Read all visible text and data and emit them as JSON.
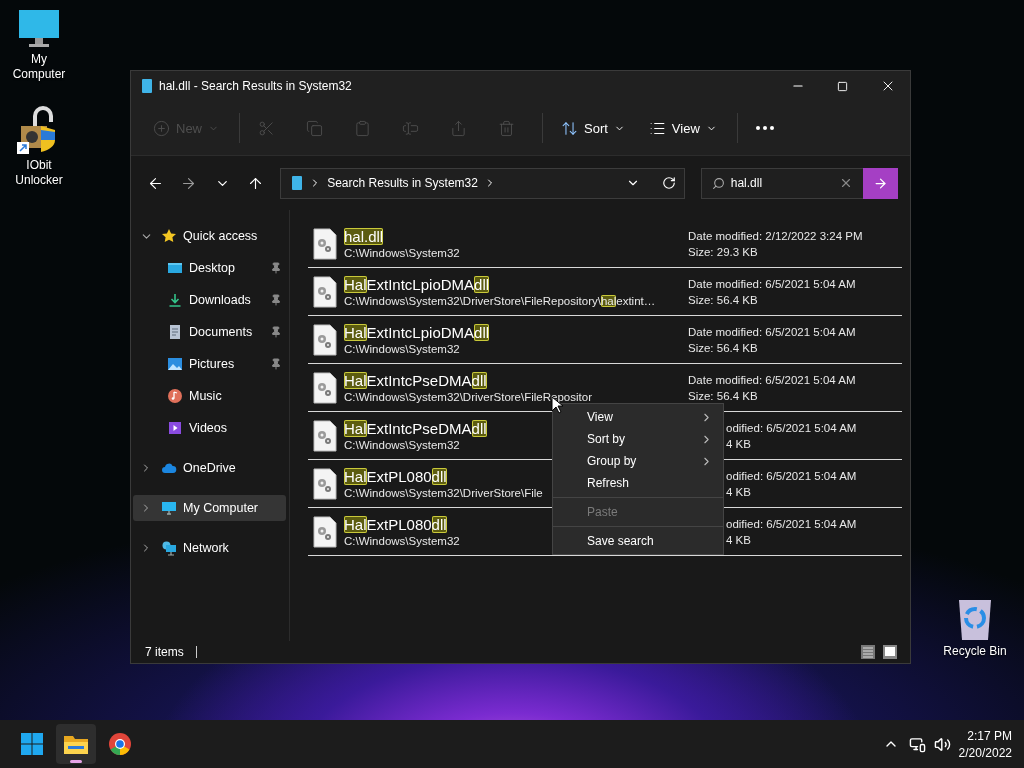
{
  "desktop_icons": [
    {
      "kind": "computer",
      "label": "My Computer"
    },
    {
      "kind": "unlocker",
      "label": "IObit Unlocker"
    },
    {
      "kind": "recycle",
      "label": "Recycle Bin"
    }
  ],
  "window": {
    "title": "hal.dll - Search Results in System32",
    "toolbar": [
      {
        "kind": "new",
        "label": "New",
        "disabled": true
      },
      {
        "kind": "separator"
      },
      {
        "kind": "cut",
        "disabled": true
      },
      {
        "kind": "copy",
        "disabled": true
      },
      {
        "kind": "paste",
        "disabled": true
      },
      {
        "kind": "rename",
        "disabled": true
      },
      {
        "kind": "share",
        "disabled": true
      },
      {
        "kind": "delete",
        "disabled": true
      },
      {
        "kind": "separator"
      },
      {
        "kind": "sort",
        "label": "Sort",
        "disabled": false
      },
      {
        "kind": "view",
        "label": "View",
        "disabled": false
      },
      {
        "kind": "separator"
      },
      {
        "kind": "more",
        "disabled": false
      }
    ],
    "address": {
      "crumb": "Search Results in System32"
    },
    "search": {
      "value": "hal.dll"
    },
    "sidebar": [
      {
        "kind": "star",
        "label": "Quick access",
        "expanded": true,
        "selected": false,
        "children": [
          {
            "kind": "desktop",
            "label": "Desktop",
            "pinned": true,
            "selected": false
          },
          {
            "kind": "download",
            "label": "Downloads",
            "pinned": true,
            "selected": false
          },
          {
            "kind": "documents",
            "label": "Documents",
            "pinned": true,
            "selected": false
          },
          {
            "kind": "pictures",
            "label": "Pictures",
            "pinned": true,
            "selected": false
          },
          {
            "kind": "music",
            "label": "Music",
            "pinned": false,
            "selected": false
          },
          {
            "kind": "videos",
            "label": "Videos",
            "pinned": false,
            "selected": false
          }
        ]
      },
      {
        "kind": "cloud",
        "label": "OneDrive",
        "expanded": false,
        "selected": false
      },
      {
        "kind": "computer",
        "label": "My Computer",
        "expanded": false,
        "selected": true
      },
      {
        "kind": "network",
        "label": "Network",
        "expanded": false,
        "selected": false
      }
    ],
    "results": [
      {
        "kind": "full",
        "name": [
          {
            "text": "hal.dll",
            "match": true
          }
        ],
        "path": [
          {
            "text": "C:\\Windows\\System32",
            "match": false
          }
        ],
        "date": "Date modified: 2/12/2022 3:24 PM",
        "size": "Size: 29.3 KB"
      },
      {
        "kind": "full",
        "name": [
          {
            "text": "Hal",
            "match": true
          },
          {
            "text": "ExtIntcLpioDMA",
            "match": false
          },
          {
            "text": "dll",
            "match": true
          }
        ],
        "path": [
          {
            "text": "C:\\Windows\\System32\\DriverStore\\FileRepository\\",
            "match": false
          },
          {
            "text": "hal",
            "match": true
          },
          {
            "text": "extint…",
            "match": false
          }
        ],
        "date": "Date modified: 6/5/2021 5:04 AM",
        "size": "Size: 56.4 KB"
      },
      {
        "kind": "full",
        "name": [
          {
            "text": "Hal",
            "match": true
          },
          {
            "text": "ExtIntcLpioDMA",
            "match": false
          },
          {
            "text": "dll",
            "match": true
          }
        ],
        "path": [
          {
            "text": "C:\\Windows\\System32",
            "match": false
          }
        ],
        "date": "Date modified: 6/5/2021 5:04 AM",
        "size": "Size: 56.4 KB"
      },
      {
        "kind": "full",
        "name": [
          {
            "text": "Hal",
            "match": true
          },
          {
            "text": "ExtIntcPseDMA",
            "match": false
          },
          {
            "text": "dll",
            "match": true
          }
        ],
        "path": [
          {
            "text": "C:\\Windows\\System32\\DriverStore\\FileRepositor",
            "match": false
          }
        ],
        "date": "Date modified: 6/5/2021 5:04 AM",
        "size": "Size: 56.4 KB"
      },
      {
        "kind": "covered",
        "name": [
          {
            "text": "Hal",
            "match": true
          },
          {
            "text": "ExtIntcPseDMA",
            "match": false
          },
          {
            "text": "dll",
            "match": true
          }
        ],
        "path": [
          {
            "text": "C:\\Windows\\System32",
            "match": false
          }
        ],
        "date": "odified: 6/5/2021 5:04 AM",
        "size": "4 KB"
      },
      {
        "kind": "covered",
        "name": [
          {
            "text": "Hal",
            "match": true
          },
          {
            "text": "ExtPL080",
            "match": false
          },
          {
            "text": "dll",
            "match": true
          }
        ],
        "path": [
          {
            "text": "C:\\Windows\\System32\\DriverStore\\File",
            "match": false
          }
        ],
        "date": "odified: 6/5/2021 5:04 AM",
        "size": "4 KB"
      },
      {
        "kind": "covered",
        "name": [
          {
            "text": "Hal",
            "match": true
          },
          {
            "text": "ExtPL080",
            "match": false
          },
          {
            "text": "dll",
            "match": true
          }
        ],
        "path": [
          {
            "text": "C:\\Windows\\System32",
            "match": false
          }
        ],
        "date": "odified: 6/5/2021 5:04 AM",
        "size": "4 KB"
      }
    ],
    "context_menu": [
      {
        "kind": "item",
        "label": "View",
        "submenu": true,
        "disabled": false
      },
      {
        "kind": "item",
        "label": "Sort by",
        "submenu": true,
        "disabled": false
      },
      {
        "kind": "item",
        "label": "Group by",
        "submenu": true,
        "disabled": false
      },
      {
        "kind": "item",
        "label": "Refresh",
        "submenu": false,
        "disabled": false
      },
      {
        "kind": "separator"
      },
      {
        "kind": "item",
        "label": "Paste",
        "submenu": false,
        "disabled": true
      },
      {
        "kind": "separator"
      },
      {
        "kind": "item",
        "label": "Save search",
        "submenu": false,
        "disabled": false
      }
    ],
    "status": {
      "count": "7 items"
    }
  },
  "taskbar": {
    "apps": [
      {
        "kind": "start",
        "selected": false
      },
      {
        "kind": "explorer",
        "selected": true
      },
      {
        "kind": "chrome",
        "selected": false
      }
    ],
    "time": "2:17 PM",
    "date": "2/20/2022"
  }
}
